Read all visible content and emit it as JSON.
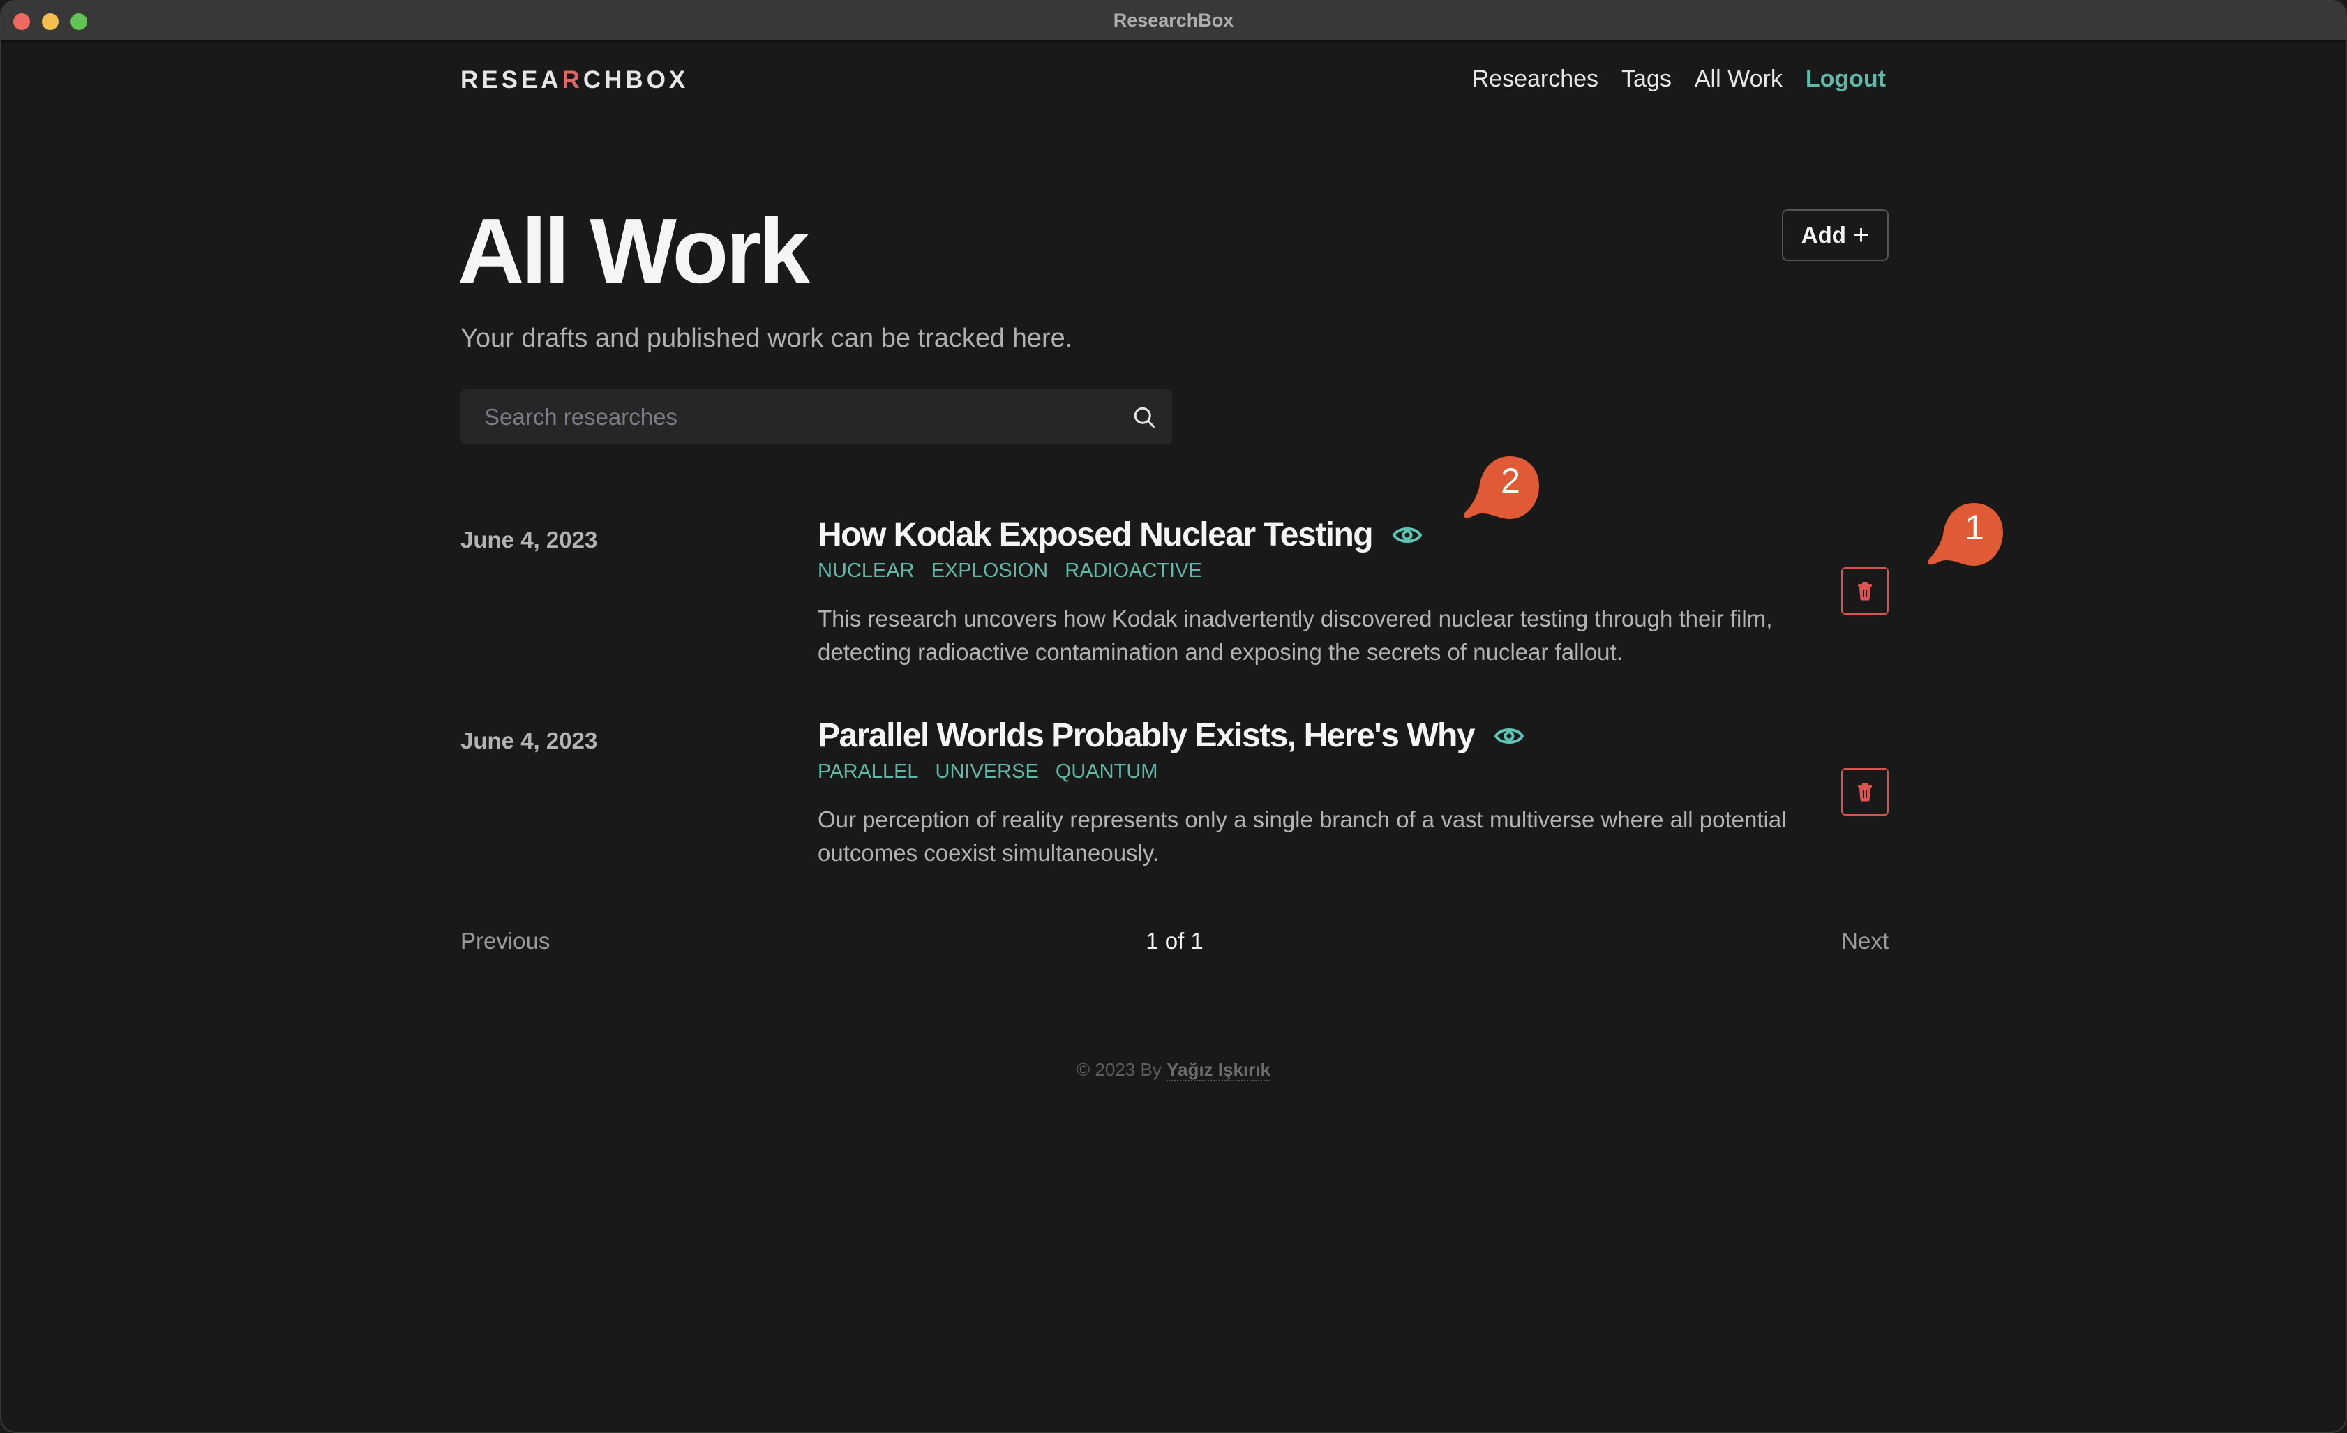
{
  "window": {
    "title": "ResearchBox"
  },
  "header": {
    "logo_parts": [
      "RESEA",
      "R",
      "CHBOX"
    ],
    "nav": [
      {
        "label": "Researches"
      },
      {
        "label": "Tags"
      },
      {
        "label": "All Work"
      },
      {
        "label": "Logout"
      }
    ]
  },
  "page": {
    "title": "All Work",
    "subtitle": "Your drafts and published work can be tracked here.",
    "add_label": "Add",
    "add_icon": "+",
    "search": {
      "placeholder": "Search researches",
      "value": ""
    }
  },
  "researches": [
    {
      "date": "June 4, 2023",
      "title": "How Kodak Exposed Nuclear Testing",
      "visibility_icon": "eye-icon",
      "tags": [
        "NUCLEAR",
        "EXPLOSION",
        "RADIOACTIVE"
      ],
      "description": "This research uncovers how Kodak inadvertently discovered nuclear testing through their film, detecting radioactive contamination and exposing the secrets of nuclear fallout."
    },
    {
      "date": "June 4, 2023",
      "title": "Parallel Worlds Probably Exists, Here's Why",
      "visibility_icon": "eye-icon",
      "tags": [
        "PARALLEL",
        "UNIVERSE",
        "QUANTUM"
      ],
      "description": "Our perception of reality represents only a single branch of a vast multiverse where all potential outcomes coexist simultaneously."
    }
  ],
  "pagination": {
    "previous": "Previous",
    "page_info": "1 of 1",
    "next": "Next"
  },
  "footer": {
    "prefix": "© 2023 By",
    "author": "Yağız Işkırık"
  },
  "annotations": [
    {
      "label": "1"
    },
    {
      "label": "2"
    }
  ],
  "colors": {
    "accent": "#5fb8a8",
    "danger": "#d9534f",
    "badge": "#e05a35",
    "background": "#191919"
  }
}
